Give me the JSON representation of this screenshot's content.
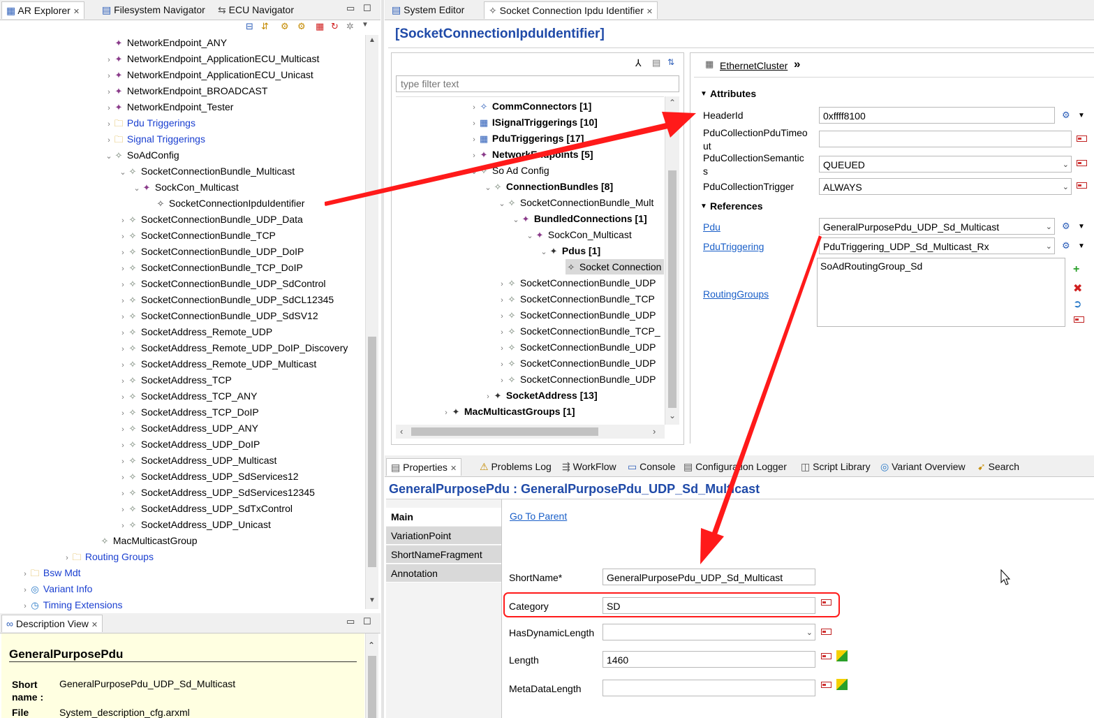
{
  "left_tabs": {
    "ar_explorer": "AR Explorer",
    "filesystem_navigator": "Filesystem Navigator",
    "ecu_navigator": "ECU Navigator"
  },
  "left_tree": [
    {
      "label": "NetworkEndpoint_ANY"
    },
    {
      "label": "NetworkEndpoint_ApplicationECU_Multicast"
    },
    {
      "label": "NetworkEndpoint_ApplicationECU_Unicast"
    },
    {
      "label": "NetworkEndpoint_BROADCAST"
    },
    {
      "label": "NetworkEndpoint_Tester"
    },
    {
      "label": "Pdu Triggerings"
    },
    {
      "label": "Signal Triggerings"
    },
    {
      "label": "SoAdConfig"
    },
    {
      "label": "SocketConnectionBundle_Multicast"
    },
    {
      "label": "SockCon_Multicast"
    },
    {
      "label": "SocketConnectionIpduIdentifier"
    },
    {
      "label": "SocketConnectionBundle_UDP_Data"
    },
    {
      "label": "SocketConnectionBundle_TCP"
    },
    {
      "label": "SocketConnectionBundle_UDP_DoIP"
    },
    {
      "label": "SocketConnectionBundle_TCP_DoIP"
    },
    {
      "label": "SocketConnectionBundle_UDP_SdControl"
    },
    {
      "label": "SocketConnectionBundle_UDP_SdCL12345"
    },
    {
      "label": "SocketConnectionBundle_UDP_SdSV12"
    },
    {
      "label": "SocketAddress_Remote_UDP"
    },
    {
      "label": "SocketAddress_Remote_UDP_DoIP_Discovery"
    },
    {
      "label": "SocketAddress_Remote_UDP_Multicast"
    },
    {
      "label": "SocketAddress_TCP"
    },
    {
      "label": "SocketAddress_TCP_ANY"
    },
    {
      "label": "SocketAddress_TCP_DoIP"
    },
    {
      "label": "SocketAddress_UDP_ANY"
    },
    {
      "label": "SocketAddress_UDP_DoIP"
    },
    {
      "label": "SocketAddress_UDP_Multicast"
    },
    {
      "label": "SocketAddress_UDP_SdServices12"
    },
    {
      "label": "SocketAddress_UDP_SdServices12345"
    },
    {
      "label": "SocketAddress_UDP_SdTxControl"
    },
    {
      "label": "SocketAddress_UDP_Unicast"
    },
    {
      "label": "MacMulticastGroup"
    },
    {
      "label": "Routing Groups"
    },
    {
      "label": "Bsw Mdt"
    },
    {
      "label": "Variant Info"
    },
    {
      "label": "Timing Extensions"
    }
  ],
  "description_view": {
    "tab": "Description View",
    "title": "GeneralPurposePdu",
    "short_name_label": "Short name :",
    "short_name_value": "GeneralPurposePdu_UDP_Sd_Multicast",
    "file_label": "File",
    "file_value": "System_description_cfg.arxml"
  },
  "editor_tabs": {
    "system_editor": "System Editor",
    "socket_editor": "Socket Connection Ipdu Identifier"
  },
  "editor_title": "[SocketConnectionIpduIdentifier]",
  "filter_placeholder": "type filter text",
  "mid_tree": [
    {
      "label": "CommConnectors [1]"
    },
    {
      "label": "ISignalTriggerings [10]"
    },
    {
      "label": "PduTriggerings [17]"
    },
    {
      "label": "NetworkEndpoints [5]"
    },
    {
      "label": "So Ad Config"
    },
    {
      "label": "ConnectionBundles [8]"
    },
    {
      "label": "SocketConnectionBundle_Mult"
    },
    {
      "label": "BundledConnections [1]"
    },
    {
      "label": "SockCon_Multicast"
    },
    {
      "label": "Pdus [1]"
    },
    {
      "label": "Socket Connection"
    },
    {
      "label": "SocketConnectionBundle_UDP"
    },
    {
      "label": "SocketConnectionBundle_TCP"
    },
    {
      "label": "SocketConnectionBundle_UDP"
    },
    {
      "label": "SocketConnectionBundle_TCP_"
    },
    {
      "label": "SocketConnectionBundle_UDP"
    },
    {
      "label": "SocketConnectionBundle_UDP"
    },
    {
      "label": "SocketConnectionBundle_UDP"
    },
    {
      "label": "SocketAddress [13]"
    },
    {
      "label": "MacMulticastGroups [1]"
    }
  ],
  "detail": {
    "breadcrumb": "EthernetCluster",
    "attributes_header": "Attributes",
    "header_id_label": "HeaderId",
    "header_id_value": "0xffff8100",
    "pdu_timeout_label_1": "PduCollectionPduTimeo",
    "pdu_timeout_label_2": "ut",
    "pdu_timeout_value": "",
    "pdu_semantics_label_1": "PduCollectionSemantic",
    "pdu_semantics_label_2": "s",
    "pdu_semantics_value": "QUEUED",
    "pdu_trigger_label": "PduCollectionTrigger",
    "pdu_trigger_value": "ALWAYS",
    "references_header": "References",
    "pdu_label": "Pdu",
    "pdu_value": "GeneralPurposePdu_UDP_Sd_Multicast",
    "pdu_triggering_label": "PduTriggering",
    "pdu_triggering_value": "PduTriggering_UDP_Sd_Multicast_Rx",
    "routing_groups_label": "RoutingGroups",
    "routing_groups_value": "SoAdRoutingGroup_Sd"
  },
  "bottom_tabs": [
    "Properties",
    "Problems Log",
    "WorkFlow",
    "Console",
    "Configuration Logger",
    "Script Library",
    "Variant Overview",
    "Search"
  ],
  "properties": {
    "title": "GeneralPurposePdu : GeneralPurposePdu_UDP_Sd_Multicast",
    "go_to_parent": "Go To Parent",
    "side_tabs": [
      "Main",
      "VariationPoint",
      "ShortNameFragment",
      "Annotation"
    ],
    "short_name_label": "ShortName*",
    "short_name_value": "GeneralPurposePdu_UDP_Sd_Multicast",
    "category_label": "Category",
    "category_value": "SD",
    "has_dynamic_length_label": "HasDynamicLength",
    "has_dynamic_length_value": "",
    "length_label": "Length",
    "length_value": "1460",
    "meta_data_length_label": "MetaDataLength",
    "meta_data_length_value": ""
  },
  "colors": {
    "annotation_red": "#ff1a1a",
    "link_blue": "#1a5fc8",
    "tree_blue": "#1a3fd0",
    "title_blue": "#1f4aa8"
  }
}
